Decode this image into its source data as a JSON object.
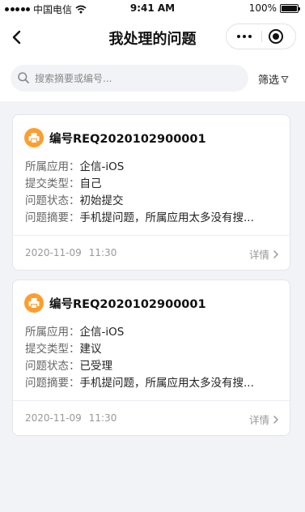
{
  "status_bar": {
    "carrier": "中国电信",
    "time": "9:41 AM",
    "battery": "100%"
  },
  "nav": {
    "title": "我处理的问题"
  },
  "search": {
    "placeholder": "搜索摘要或编号...",
    "value": "",
    "filter_label": "筛选"
  },
  "cards": [
    {
      "number": "编号REQ2020102900001",
      "fields": [
        {
          "label": "所属应用",
          "value": "企信-iOS"
        },
        {
          "label": "提交类型",
          "value": "自己"
        },
        {
          "label": "问题状态",
          "value": "初始提交"
        },
        {
          "label": "问题摘要",
          "value": "手机提问题，所属应用太多没有搜..."
        }
      ],
      "date": "2020-11-09",
      "time": "11:30",
      "detail_label": "详情"
    },
    {
      "number": "编号REQ2020102900001",
      "fields": [
        {
          "label": "所属应用",
          "value": "企信-iOS"
        },
        {
          "label": "提交类型",
          "value": "建议"
        },
        {
          "label": "问题状态",
          "value": "已受理"
        },
        {
          "label": "问题摘要",
          "value": "手机提问题，所属应用太多没有搜..."
        }
      ],
      "date": "2020-11-09",
      "time": "11:30",
      "detail_label": "详情"
    }
  ],
  "colors": {
    "accent": "#ff9d2e",
    "page_background": "#f2f3f7",
    "muted_text": "#999999"
  },
  "icons": {
    "signal": "signal-dots-icon",
    "wifi": "wifi-icon",
    "battery": "battery-icon",
    "back": "chevron-left-icon",
    "more": "more-dots-icon",
    "close": "close-circle-icon",
    "search": "search-icon",
    "filter": "filter-icon",
    "card": "printer-icon",
    "detail": "chevron-right-icon"
  }
}
